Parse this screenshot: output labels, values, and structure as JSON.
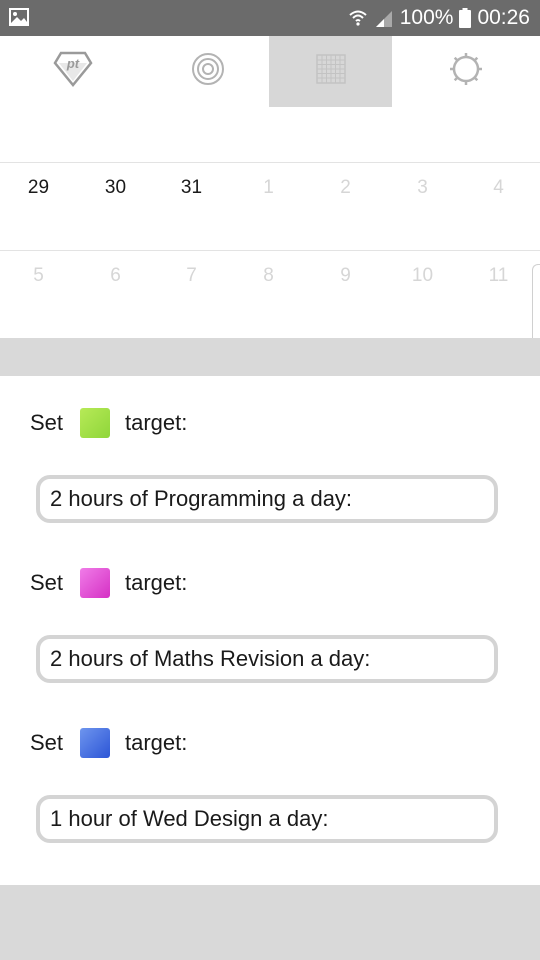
{
  "status_bar": {
    "battery": "100%",
    "time": "00:26",
    "icons": [
      "image-notification-icon",
      "wifi-icon",
      "signal-icon",
      "battery-icon"
    ]
  },
  "nav": {
    "tabs": [
      {
        "name": "pt-logo-icon",
        "active": false
      },
      {
        "name": "target-icon",
        "active": false
      },
      {
        "name": "calendar-grid-icon",
        "active": true
      },
      {
        "name": "gear-icon",
        "active": false
      }
    ]
  },
  "calendar": {
    "rows": [
      [
        {
          "label": "29",
          "muted": false
        },
        {
          "label": "30",
          "muted": false
        },
        {
          "label": "31",
          "muted": false
        },
        {
          "label": "1",
          "muted": true
        },
        {
          "label": "2",
          "muted": true
        },
        {
          "label": "3",
          "muted": true
        },
        {
          "label": "4",
          "muted": true
        }
      ],
      [
        {
          "label": "5",
          "muted": true
        },
        {
          "label": "6",
          "muted": true
        },
        {
          "label": "7",
          "muted": true
        },
        {
          "label": "8",
          "muted": true
        },
        {
          "label": "9",
          "muted": true
        },
        {
          "label": "10",
          "muted": true
        },
        {
          "label": "11",
          "muted": true
        }
      ]
    ]
  },
  "targets": [
    {
      "set_label": "Set",
      "target_label": "target:",
      "color_from": "#b7ea57",
      "color_to": "#8fd63a",
      "value": "2 hours of Programming a day:"
    },
    {
      "set_label": "Set",
      "target_label": "target:",
      "color_from": "#f07ce8",
      "color_to": "#d530c4",
      "value": "2 hours of Maths Revision a day:"
    },
    {
      "set_label": "Set",
      "target_label": "target:",
      "color_from": "#6e95ee",
      "color_to": "#2c55d6",
      "value": "1 hour of Wed Design a day:"
    }
  ]
}
